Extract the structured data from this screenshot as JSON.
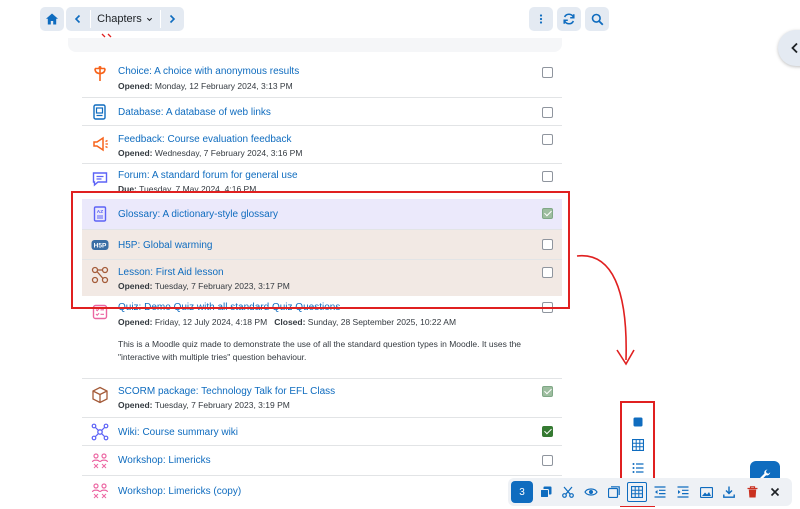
{
  "nav": {
    "chapters_label": "Chapters",
    "home_icon": "home-icon",
    "prev_icon": "chevron-left-icon",
    "next_icon": "chevron-right-icon",
    "more_icon": "kebab-icon",
    "refresh_icon": "refresh-icon",
    "search_icon": "search-icon"
  },
  "activities": [
    {
      "icon": "choice-icon",
      "title": "Choice: A choice with anonymous results",
      "meta_label": "Opened:",
      "meta_value": "Monday, 12 February 2024, 3:13 PM",
      "checked": false
    },
    {
      "icon": "database-icon",
      "title": "Database: A database of web links",
      "checked": false
    },
    {
      "icon": "feedback-icon",
      "title": "Feedback: Course evaluation feedback",
      "meta_label": "Opened:",
      "meta_value": "Wednesday, 7 February 2024, 3:16 PM",
      "checked": false
    },
    {
      "icon": "forum-icon",
      "title": "Forum: A standard forum for general use",
      "meta_label": "Due:",
      "meta_value": "Tuesday, 7 May 2024, 4:16 PM",
      "checked": false
    },
    {
      "icon": "glossary-icon",
      "title": "Glossary: A dictionary-style glossary",
      "checked": true
    },
    {
      "icon": "h5p-icon",
      "icon_text": "H5P",
      "title": "H5P: Global warming",
      "checked": false
    },
    {
      "icon": "lesson-icon",
      "title": "Lesson: First Aid lesson",
      "meta_label": "Opened:",
      "meta_value": "Tuesday, 7 February 2023, 3:17 PM",
      "checked": false
    },
    {
      "icon": "quiz-icon",
      "title": "Quiz: Demo Quiz with all standard Quiz Questions",
      "meta_label": "Opened:",
      "meta_value": "Friday, 12 July 2024, 4:18 PM",
      "meta2_label": "Closed:",
      "meta2_value": "Sunday, 28 September 2025, 10:22 AM",
      "description": "This is a Moodle quiz made to demonstrate the use of all the standard question types in Moodle. It uses the \"interactive with multiple tries\" question behaviour.",
      "checked": false
    },
    {
      "icon": "scorm-icon",
      "title": "SCORM package: Technology Talk for EFL Class",
      "meta_label": "Opened:",
      "meta_value": "Tuesday, 7 February 2023, 3:19 PM",
      "checked": true
    },
    {
      "icon": "wiki-icon",
      "title": "Wiki: Course summary wiki",
      "checked": true
    },
    {
      "icon": "workshop-icon",
      "title": "Workshop: Limericks",
      "checked": false
    },
    {
      "icon": "workshop-icon",
      "title": "Workshop: Limericks (copy)",
      "checked": false
    }
  ],
  "bulk_toolbar": {
    "selected_count": "3",
    "actions": [
      "duplicate-icon",
      "cut-icon",
      "eye-icon",
      "copy-icon",
      "grid-icon",
      "indent-left-icon",
      "indent-right-icon",
      "image-icon",
      "download-icon",
      "trash-icon",
      "close-icon"
    ]
  },
  "select_popover": [
    "square-icon",
    "grid-icon",
    "list-icon"
  ],
  "colors": {
    "accent": "#0f6cbf",
    "annotation_red": "#e02020",
    "highlight_purple": "#ebe9fb",
    "highlight_beige": "#f2e9e4"
  }
}
